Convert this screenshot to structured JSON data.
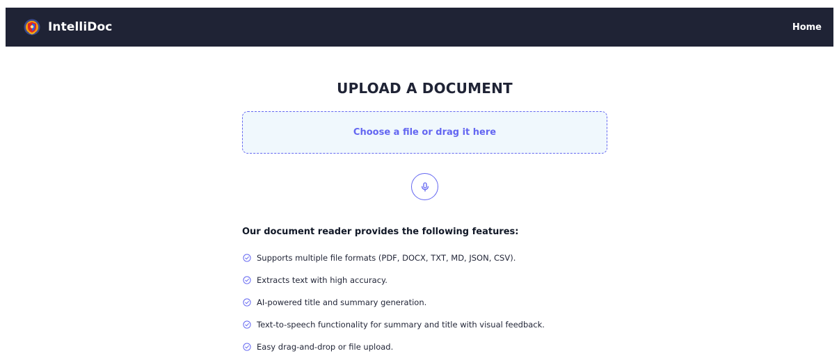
{
  "navbar": {
    "brand": "IntelliDoc",
    "logo_icon": "shield-crest-icon",
    "links": [
      {
        "label": "Home"
      }
    ]
  },
  "main": {
    "title": "UPLOAD A DOCUMENT",
    "dropzone_label": "Choose a file or drag it here",
    "mic_icon": "microphone-icon",
    "features_heading": "Our document reader provides the following features:",
    "features": [
      {
        "text": "Supports multiple file formats (PDF, DOCX, TXT, MD, JSON, CSV)."
      },
      {
        "text": "Extracts text with high accuracy."
      },
      {
        "text": "AI-powered title and summary generation."
      },
      {
        "text": "Text-to-speech functionality for summary and title with visual feedback."
      },
      {
        "text": "Easy drag-and-drop or file upload."
      }
    ]
  },
  "colors": {
    "navbar_bg": "#1f2335",
    "accent": "#6366f1",
    "dropzone_bg": "#f0f8fd"
  }
}
